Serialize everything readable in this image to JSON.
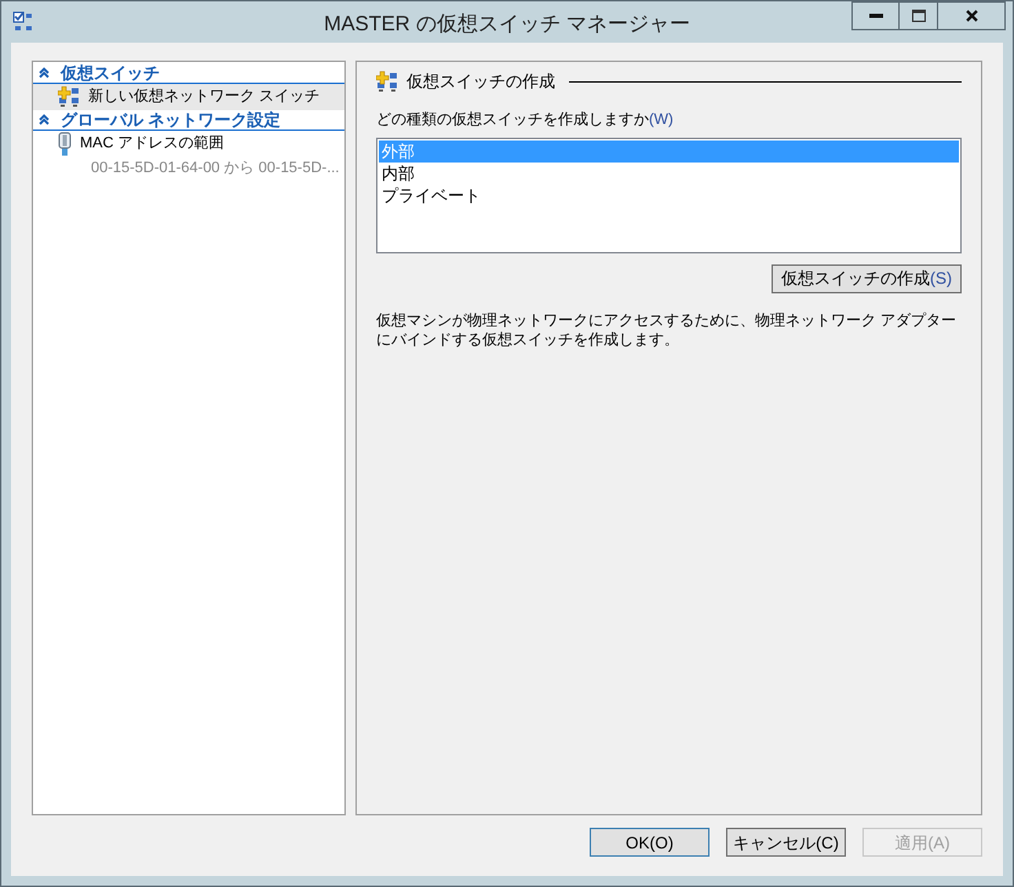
{
  "window": {
    "title": "MASTER の仮想スイッチ マネージャー"
  },
  "sidebar": {
    "sections": [
      {
        "label": "仮想スイッチ",
        "expanded": true,
        "items": [
          {
            "kind": "switch",
            "label": "新しい仮想ネットワーク スイッチ",
            "selected": true
          }
        ]
      },
      {
        "label": "グローバル ネットワーク設定",
        "expanded": true,
        "items": [
          {
            "kind": "mac",
            "label": "MAC アドレスの範囲",
            "detail": "00-15-5D-01-64-00 から 00-15-5D-...",
            "selected": false
          }
        ]
      }
    ]
  },
  "panel": {
    "title": "仮想スイッチの作成",
    "list_label": {
      "text": "どの種類の仮想スイッチを作成しますか",
      "access_key": "(W)"
    },
    "switch_types": [
      {
        "label": "外部",
        "selected": true
      },
      {
        "label": "内部",
        "selected": false
      },
      {
        "label": "プライベート",
        "selected": false
      }
    ],
    "create_button": {
      "text": "仮想スイッチの作成",
      "access_key": "(S)"
    },
    "description": "仮想マシンが物理ネットワークにアクセスするために、物理ネットワーク アダプターにバインドする仮想スイッチを作成します。"
  },
  "buttons": [
    {
      "label": "OK(O)",
      "default": true,
      "disabled": false
    },
    {
      "label": "キャンセル(C)",
      "default": false,
      "disabled": false
    },
    {
      "label": "適用(A)",
      "default": false,
      "disabled": true
    }
  ]
}
